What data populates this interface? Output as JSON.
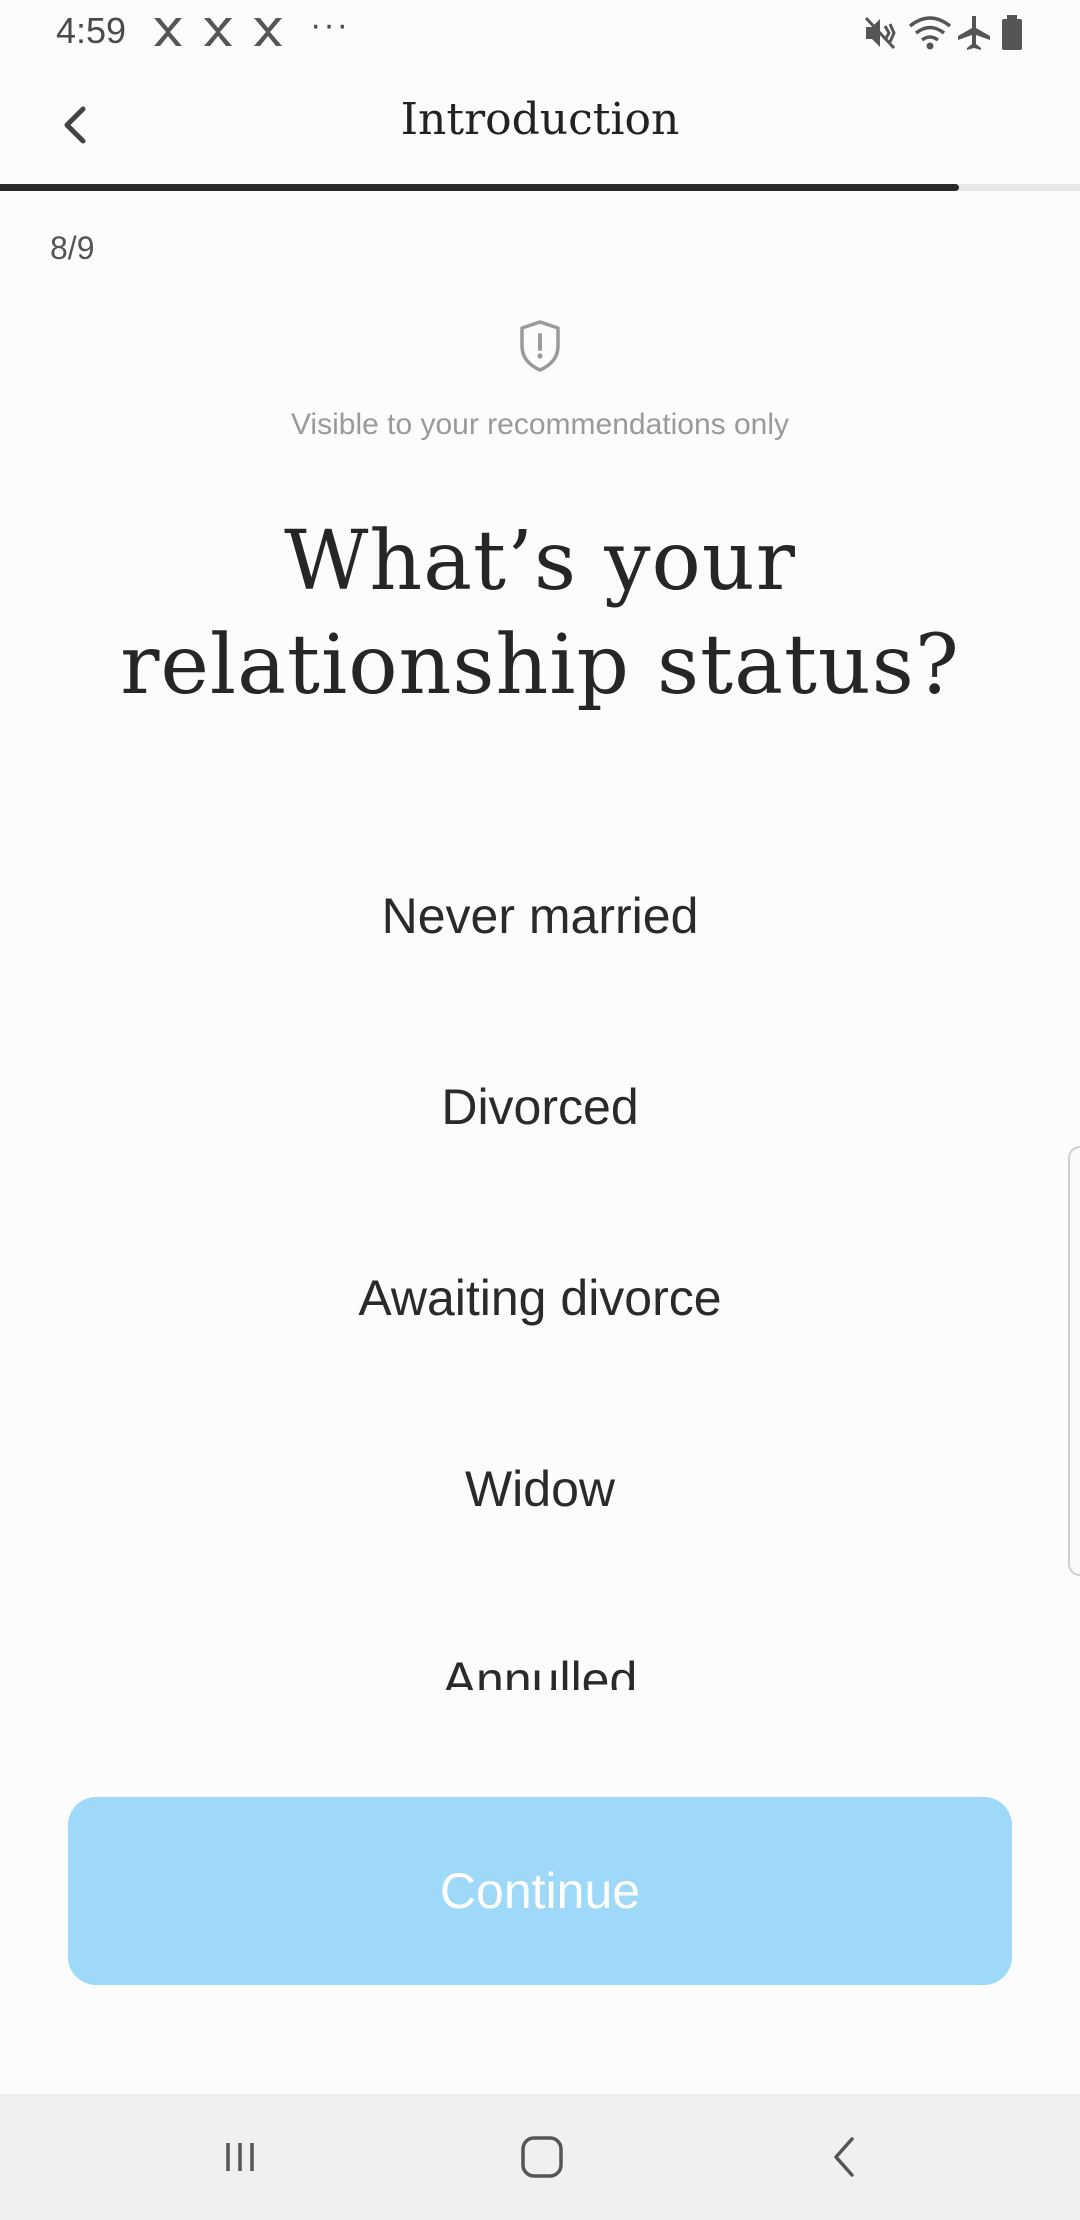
{
  "status_bar": {
    "time": "4:59",
    "notification_icons": [
      "x-shape-icon",
      "x-shape-icon",
      "x-shape-icon"
    ],
    "overflow": "···",
    "right_icons": [
      "mute-vibrate-icon",
      "wifi-icon",
      "airplane-icon",
      "battery-icon"
    ]
  },
  "header": {
    "title": "Introduction",
    "back_icon": "chevron-left-icon"
  },
  "progress": {
    "current": 8,
    "total": 9,
    "fraction": 0.888
  },
  "step_label": "8/9",
  "privacy": {
    "icon": "shield-alert-icon",
    "text": "Visible to your recommendations only"
  },
  "question": {
    "line1": "What’s your",
    "line2": "relationship status?"
  },
  "options": [
    {
      "label": "Never married"
    },
    {
      "label": "Divorced"
    },
    {
      "label": "Awaiting divorce"
    },
    {
      "label": "Widow"
    },
    {
      "label": "Annulled"
    }
  ],
  "continue_label": "Continue",
  "colors": {
    "accent": "#9fd9f9",
    "progress_fill": "#2a2a2a",
    "progress_track": "#e6e6e6"
  },
  "nav_bar": {
    "items": [
      "recent-apps-icon",
      "home-icon",
      "back-icon"
    ]
  }
}
